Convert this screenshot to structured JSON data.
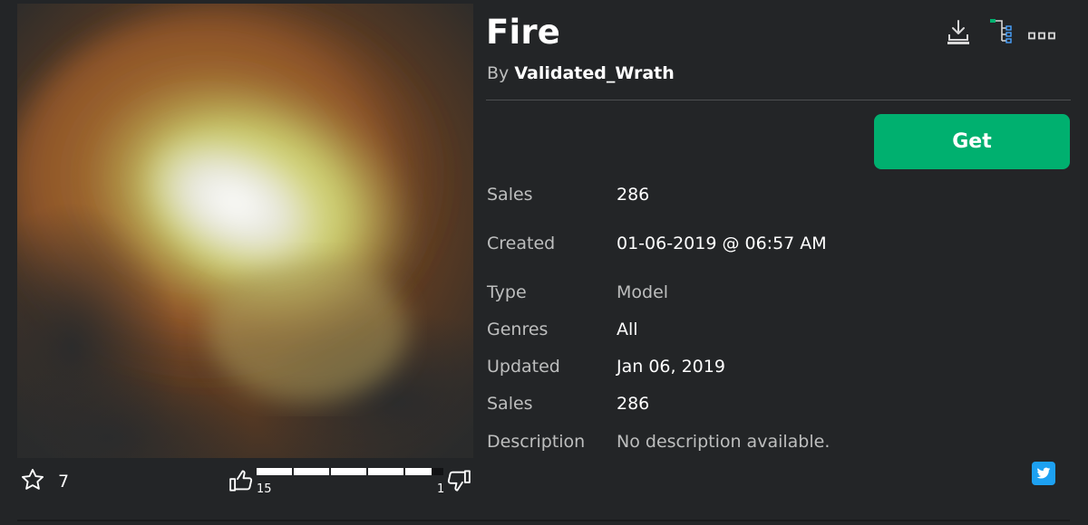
{
  "asset": {
    "title": "Fire",
    "by_label": "By",
    "creator": "Validated_Wrath",
    "get_label": "Get"
  },
  "toolbar": {
    "download_icon": "download-icon",
    "hierarchy_icon": "hierarchy-icon",
    "more_icon": "more-options-icon"
  },
  "details": [
    {
      "label": "Sales",
      "value": "286"
    },
    {
      "label": "Created",
      "value": "01-06-2019 @ 06:57 AM"
    },
    {
      "label": "Type",
      "value": "Model"
    },
    {
      "label": "Genres",
      "value": "All"
    },
    {
      "label": "Updated",
      "value": "Jan 06, 2019"
    },
    {
      "label": "Sales",
      "value": "286"
    },
    {
      "label": "Description",
      "value": "No description available."
    }
  ],
  "votes": {
    "favorites": "7",
    "upvotes": "15",
    "downvotes": "1",
    "upvote_ratio": 0.9375
  },
  "colors": {
    "background": "#232527",
    "get_button": "#00b06f",
    "twitter": "#1da1f2"
  }
}
